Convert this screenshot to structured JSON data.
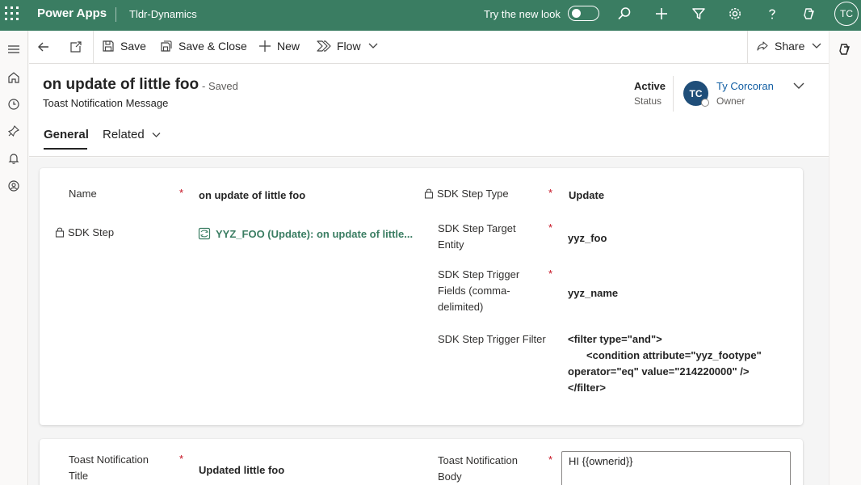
{
  "topbar": {
    "app_name": "Power Apps",
    "environment": "Tldr-Dynamics",
    "try_new_look": "Try the new look",
    "user_initials": "TC"
  },
  "commands": {
    "save": "Save",
    "save_close": "Save & Close",
    "new": "New",
    "flow": "Flow",
    "share": "Share"
  },
  "record": {
    "title": "on update of little foo",
    "saved_state": "- Saved",
    "entity": "Toast Notification Message",
    "status_value": "Active",
    "status_label": "Status",
    "owner_initials": "TC",
    "owner_name": "Ty Corcoran",
    "owner_label": "Owner"
  },
  "tabs": {
    "general": "General",
    "related": "Related"
  },
  "form": {
    "name_label": "Name",
    "name_value": "on update of little foo",
    "sdk_step_label": "SDK Step",
    "sdk_step_value": "YYZ_FOO (Update): on update of little...",
    "sdk_step_type_label": "SDK Step Type",
    "sdk_step_type_value": "Update",
    "target_entity_label_1": "SDK Step Target",
    "target_entity_label_2": "Entity",
    "target_entity_value": "yyz_foo",
    "trigger_fields_label_1": "SDK Step Trigger",
    "trigger_fields_label_2": "Fields (comma-",
    "trigger_fields_label_3": "delimited)",
    "trigger_fields_value": "yyz_name",
    "trigger_filter_label": "SDK Step Trigger Filter",
    "trigger_filter_line1": "<filter type=\"and\">",
    "trigger_filter_line2": "<condition attribute=\"yyz_footype\"",
    "trigger_filter_line3": "operator=\"eq\" value=\"214220000\" />",
    "trigger_filter_line4": "</filter>",
    "toast_title_label_1": "Toast Notification",
    "toast_title_label_2": "Title",
    "toast_title_value": "Updated little foo",
    "toast_body_label_1": "Toast Notification",
    "toast_body_label_2": "Body",
    "toast_body_value": "HI {{ownerid}}",
    "required_marker": "*"
  }
}
